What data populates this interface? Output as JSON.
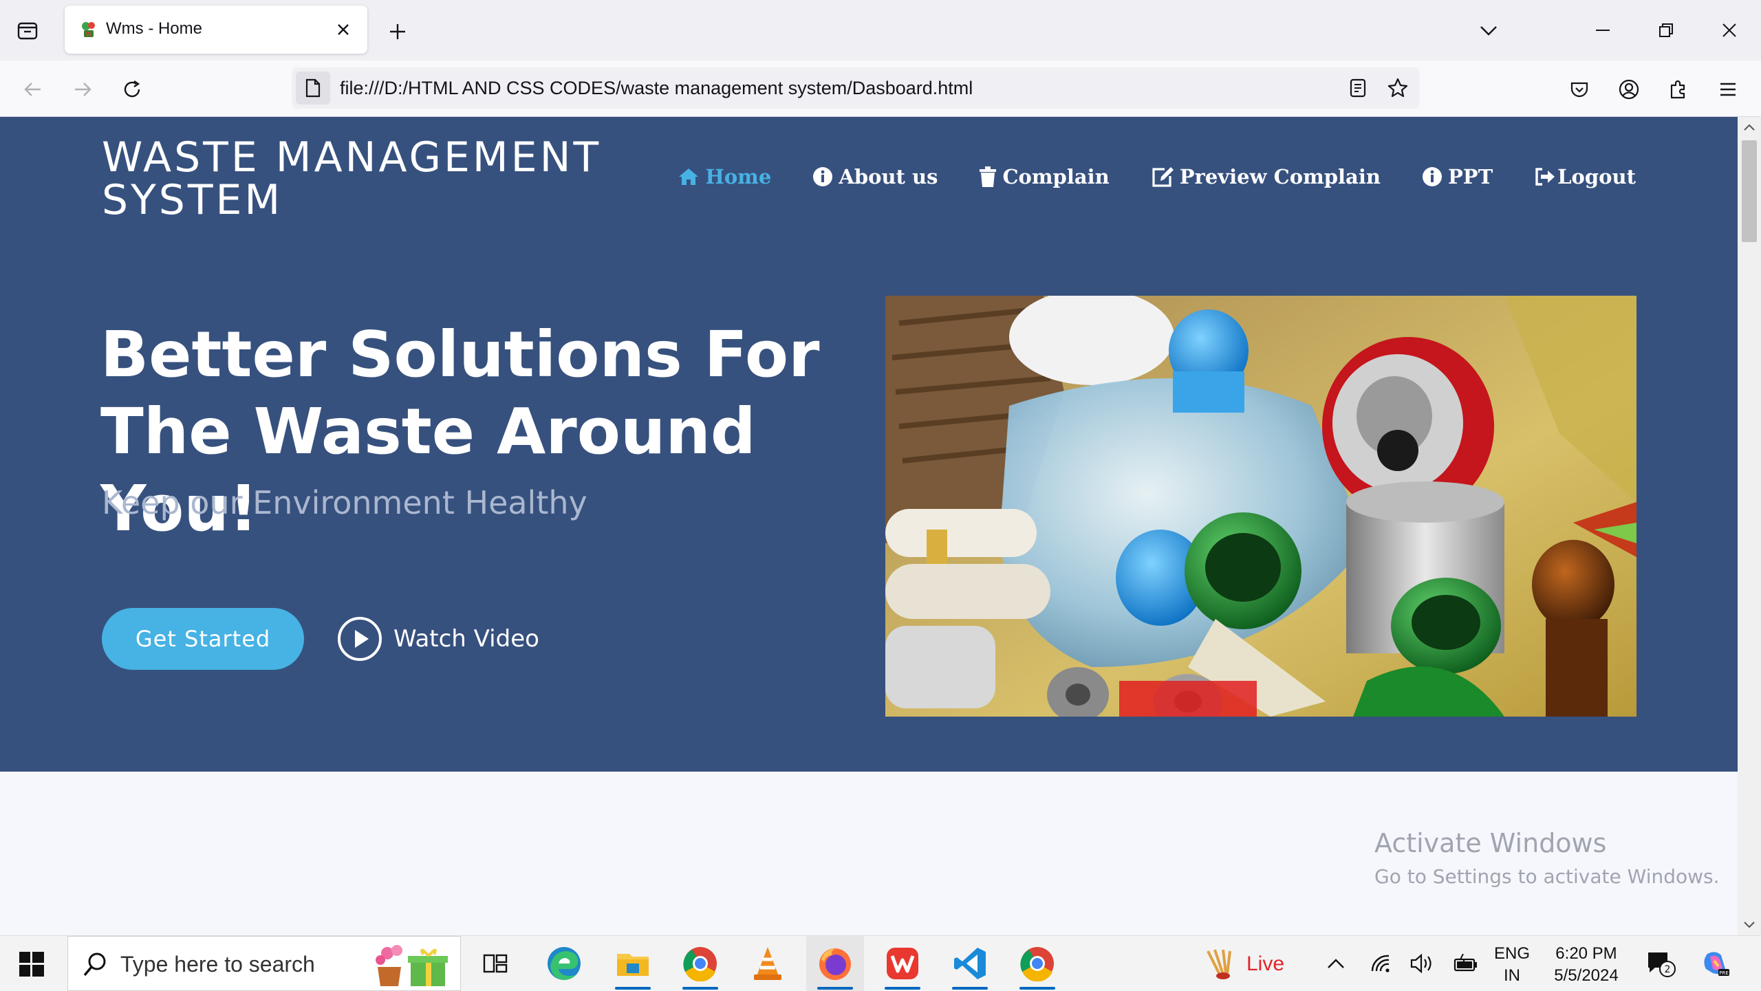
{
  "browser": {
    "tab_title": "Wms - Home",
    "url": "file:///D:/HTML AND CSS CODES/waste management system/Dasboard.html"
  },
  "site": {
    "logo_text": "WASTE MANAGEMENT SYSTEM",
    "nav": [
      {
        "label": "Home",
        "icon": "home-icon",
        "active": true
      },
      {
        "label": "About us",
        "icon": "info-icon",
        "active": false
      },
      {
        "label": "Complain",
        "icon": "trash-icon",
        "active": false
      },
      {
        "label": "Preview Complain",
        "icon": "edit-icon",
        "active": false
      },
      {
        "label": "PPT",
        "icon": "info-icon",
        "active": false
      },
      {
        "label": "Logout",
        "icon": "sign-out-icon",
        "active": false
      }
    ],
    "hero": {
      "headline": "Better Solutions For The Waste Around You!",
      "subheadline": "Keep our Environment Healthy",
      "get_started_label": "Get Started",
      "watch_video_label": "Watch Video",
      "image_subject": "recyclable-waste-photo"
    },
    "colors": {
      "hero_bg": "#37517e",
      "accent": "#47b2e4",
      "subtitle": "#aab7cf"
    }
  },
  "watermark": {
    "title": "Activate Windows",
    "subtitle": "Go to Settings to activate Windows."
  },
  "taskbar": {
    "search_placeholder": "Type here to search",
    "live_label": "Live",
    "language_line1": "ENG",
    "language_line2": "IN",
    "time": "6:20 PM",
    "date": "5/5/2024",
    "notification_count": "2",
    "apps": [
      "task-view",
      "edge",
      "file-explorer",
      "chrome",
      "vlc",
      "firefox",
      "wps-office",
      "vscode",
      "chrome"
    ]
  }
}
